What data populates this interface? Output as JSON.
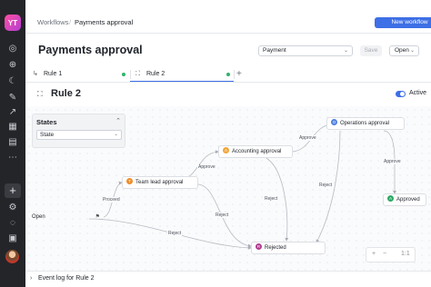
{
  "rail": {
    "logo_text": "YT",
    "icons": [
      "check-circle-icon",
      "globe-icon",
      "moon-icon",
      "pen-icon",
      "chart-icon",
      "grid-icon",
      "book-icon",
      "more-icon"
    ],
    "bottom_icons": [
      "plus-icon",
      "settings-icon",
      "bell-icon",
      "calendar-icon"
    ]
  },
  "breadcrumb": {
    "parent": "Workflows",
    "separator": "/",
    "current": "Payments approval"
  },
  "header": {
    "new_workflow_label": "New workflow",
    "title": "Payments approval",
    "more_label": "···",
    "select_value": "Payment",
    "save_label": "Save",
    "open_label": "Open"
  },
  "tabs": [
    {
      "label": "Rule 1",
      "active": false
    },
    {
      "label": "Rule 2",
      "active": true
    }
  ],
  "rule": {
    "title": "Rule 2",
    "toggle_label": "Active",
    "active": true
  },
  "states_panel": {
    "heading": "States",
    "select_value": "State"
  },
  "nodes": {
    "open": "Open",
    "team_lead": "Team lead approval",
    "accounting": "Accounting approval",
    "operations": "Operations approval",
    "approved": "Approved",
    "rejected": "Rejected"
  },
  "badges": {
    "team_lead": "T",
    "accounting": "A",
    "operations": "O",
    "approved": "A",
    "rejected": "R"
  },
  "edge_labels": {
    "proceed": "Proceed",
    "approve_1": "Approve",
    "approve_2": "Approve",
    "approve_3": "Approve",
    "reject_1": "Reject",
    "reject_2": "Reject",
    "reject_3": "Reject",
    "reject_4": "Reject"
  },
  "zoom": {
    "plus": "+",
    "minus": "−",
    "ratio": "1:1"
  },
  "footer": {
    "label": "Event log for Rule 2"
  },
  "colors": {
    "accent": "#3d6fe6",
    "rail_bg": "#242529",
    "badge_team_lead": "#f08c2a",
    "badge_accounting": "#f2a53a",
    "badge_operations": "#4f7fe0",
    "badge_approved": "#2fa866",
    "badge_rejected": "#b03e8f",
    "tab_dot": "#2fb36b"
  }
}
